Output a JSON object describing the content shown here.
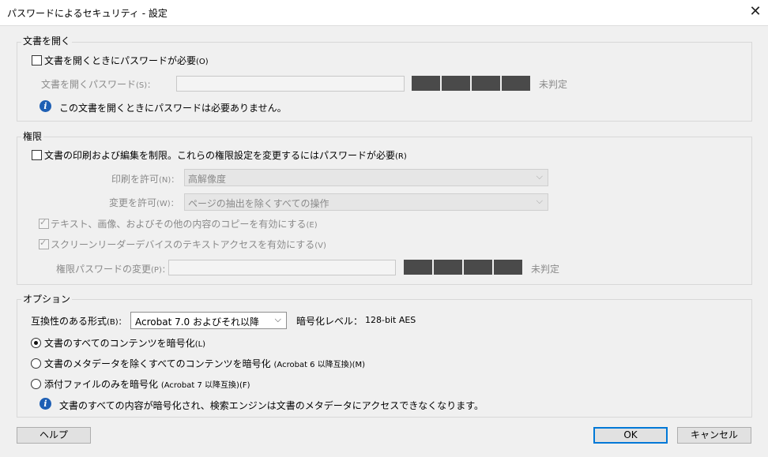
{
  "window": {
    "title": "パスワードによるセキュリティ - 設定",
    "close_glyph": "✕"
  },
  "open_section": {
    "header": "文書を開く",
    "require_checkbox_label": "文書を開くときにパスワードが必要",
    "require_checkbox_shortcut": "(O)",
    "require_checked": false,
    "password_label": "文書を開くパスワード",
    "password_shortcut": "(S)：",
    "password_value": "",
    "strength_text": "未判定",
    "info_text": "この文書を開くときにパスワードは必要ありません。"
  },
  "permissions_section": {
    "header": "権限",
    "restrict_checkbox_label": "文書の印刷および編集を制限。これらの権限設定を変更するにはパスワードが必要",
    "restrict_checkbox_shortcut": "(R)",
    "restrict_checked": false,
    "print_label": "印刷を許可",
    "print_shortcut": "(N)：",
    "print_value": "高解像度",
    "change_label": "変更を許可",
    "change_shortcut": "(W)：",
    "change_value": "ページの抽出を除くすべての操作",
    "copy_checkbox_label": "テキスト、画像、およびその他の内容のコピーを有効にする",
    "copy_checkbox_shortcut": "(E)",
    "copy_checked": true,
    "reader_checkbox_label": "スクリーンリーダーデバイスのテキストアクセスを有効にする",
    "reader_checkbox_shortcut": "(V)",
    "reader_checked": true,
    "perm_password_label": "権限パスワードの変更",
    "perm_password_shortcut": "(P)：",
    "perm_password_value": "",
    "strength_text": "未判定"
  },
  "options_section": {
    "header": "オプション",
    "compat_label": "互換性のある形式",
    "compat_shortcut": "(B)：",
    "compat_value": "Acrobat 7.0 およびそれ以降",
    "encryption_label": "暗号化レベル：",
    "encryption_value": "128-bit AES",
    "radio_all_label": "文書のすべてのコンテンツを暗号化",
    "radio_all_shortcut": "(L)",
    "radio_nometa_label": "文書のメタデータを除くすべてのコンテンツを暗号化",
    "radio_nometa_detail": "(Acrobat 6 以降互換)",
    "radio_nometa_shortcut": "(M)",
    "radio_attach_label": "添付ファイルのみを暗号化",
    "radio_attach_detail": "(Acrobat 7 以降互換)",
    "radio_attach_shortcut": "(F)",
    "selected_radio": "all",
    "info_text": "文書のすべての内容が暗号化され、検索エンジンは文書のメタデータにアクセスできなくなります。"
  },
  "buttons": {
    "help": "ヘルプ",
    "ok": "OK",
    "cancel": "キャンセル"
  },
  "icons": {
    "info": "info-icon",
    "dropdown": "chevron-down-icon",
    "close": "close-icon"
  },
  "colors": {
    "info_blue": "#1e5fb4",
    "strength_bar": "#4a4a4a",
    "default_button_border": "#0078d7"
  }
}
